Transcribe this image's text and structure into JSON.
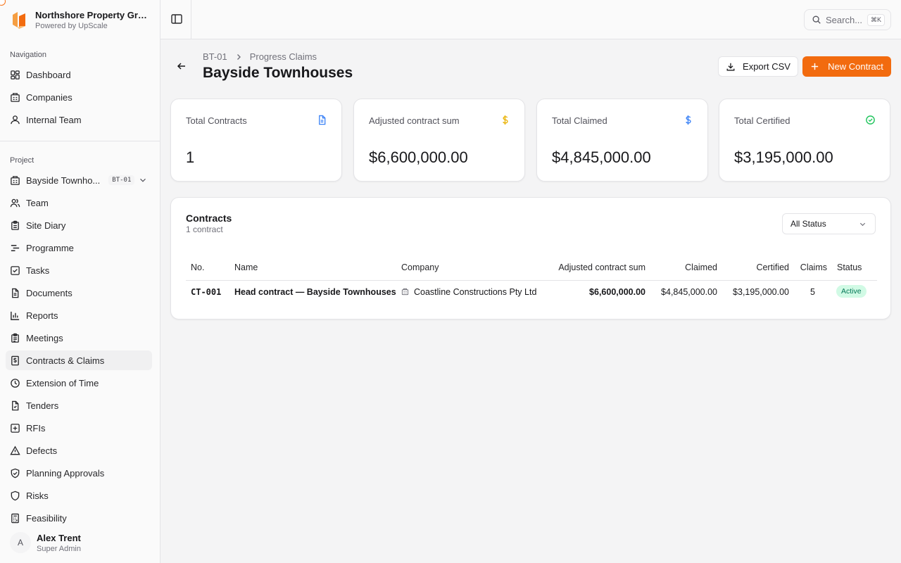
{
  "brand": {
    "name": "Northshore Property Gro...",
    "sub": "Powered by UpScale"
  },
  "sidebar": {
    "nav_label": "Navigation",
    "nav_items": [
      {
        "label": "Dashboard",
        "icon": "dashboard-icon"
      },
      {
        "label": "Companies",
        "icon": "building-icon"
      },
      {
        "label": "Internal Team",
        "icon": "user-icon"
      }
    ],
    "project_label": "Project",
    "project_selector": {
      "label": "Bayside Townho...",
      "code": "BT-01"
    },
    "project_items": [
      {
        "label": "Team",
        "icon": "users-icon"
      },
      {
        "label": "Site Diary",
        "icon": "clipboard-icon"
      },
      {
        "label": "Programme",
        "icon": "gantt-icon"
      },
      {
        "label": "Tasks",
        "icon": "checkbox-icon"
      },
      {
        "label": "Documents",
        "icon": "document-icon"
      },
      {
        "label": "Reports",
        "icon": "bar-chart-icon"
      },
      {
        "label": "Meetings",
        "icon": "clipboard-list-icon"
      },
      {
        "label": "Contracts & Claims",
        "icon": "receipt-icon",
        "active": true
      },
      {
        "label": "Extension of Time",
        "icon": "clock-icon"
      },
      {
        "label": "Tenders",
        "icon": "file-text-icon"
      },
      {
        "label": "RFIs",
        "icon": "message-plus-icon"
      },
      {
        "label": "Defects",
        "icon": "alert-triangle-icon"
      },
      {
        "label": "Planning Approvals",
        "icon": "shield-check-icon"
      },
      {
        "label": "Risks",
        "icon": "shield-icon"
      },
      {
        "label": "Feasibility",
        "icon": "calculator-icon"
      }
    ],
    "user": {
      "initial": "A",
      "name": "Alex Trent",
      "role": "Super Admin"
    }
  },
  "topbar": {
    "search_placeholder": "Search...",
    "shortcut": "⌘K"
  },
  "header": {
    "breadcrumb_code": "BT-01",
    "breadcrumb_page": "Progress Claims",
    "title": "Bayside Townhouses",
    "export_label": "Export CSV",
    "new_label": "New Contract"
  },
  "stats": [
    {
      "label": "Total Contracts",
      "value": "1",
      "icon": "file-icon",
      "color": "#3b82f6"
    },
    {
      "label": "Adjusted contract sum",
      "value": "$6,600,000.00",
      "icon": "dollar-icon",
      "color": "#eab308"
    },
    {
      "label": "Total Claimed",
      "value": "$4,845,000.00",
      "icon": "dollar-icon",
      "color": "#3b82f6"
    },
    {
      "label": "Total Certified",
      "value": "$3,195,000.00",
      "icon": "check-circle-icon",
      "color": "#22c55e"
    }
  ],
  "contracts": {
    "title": "Contracts",
    "subtitle": "1 contract",
    "filter": "All Status",
    "columns": [
      "No.",
      "Name",
      "Company",
      "Adjusted contract sum",
      "Claimed",
      "Certified",
      "Claims",
      "Status"
    ],
    "rows": [
      {
        "no": "CT-001",
        "name": "Head contract — Bayside Townhouses",
        "company": "Coastline Constructions Pty Ltd",
        "adjusted": "$6,600,000.00",
        "claimed": "$4,845,000.00",
        "certified": "$3,195,000.00",
        "claims": "5",
        "status": "Active"
      }
    ]
  },
  "colors": {
    "accent": "#f26b0f",
    "active_badge_bg": "#d1fae5",
    "active_badge_text": "#047857"
  }
}
